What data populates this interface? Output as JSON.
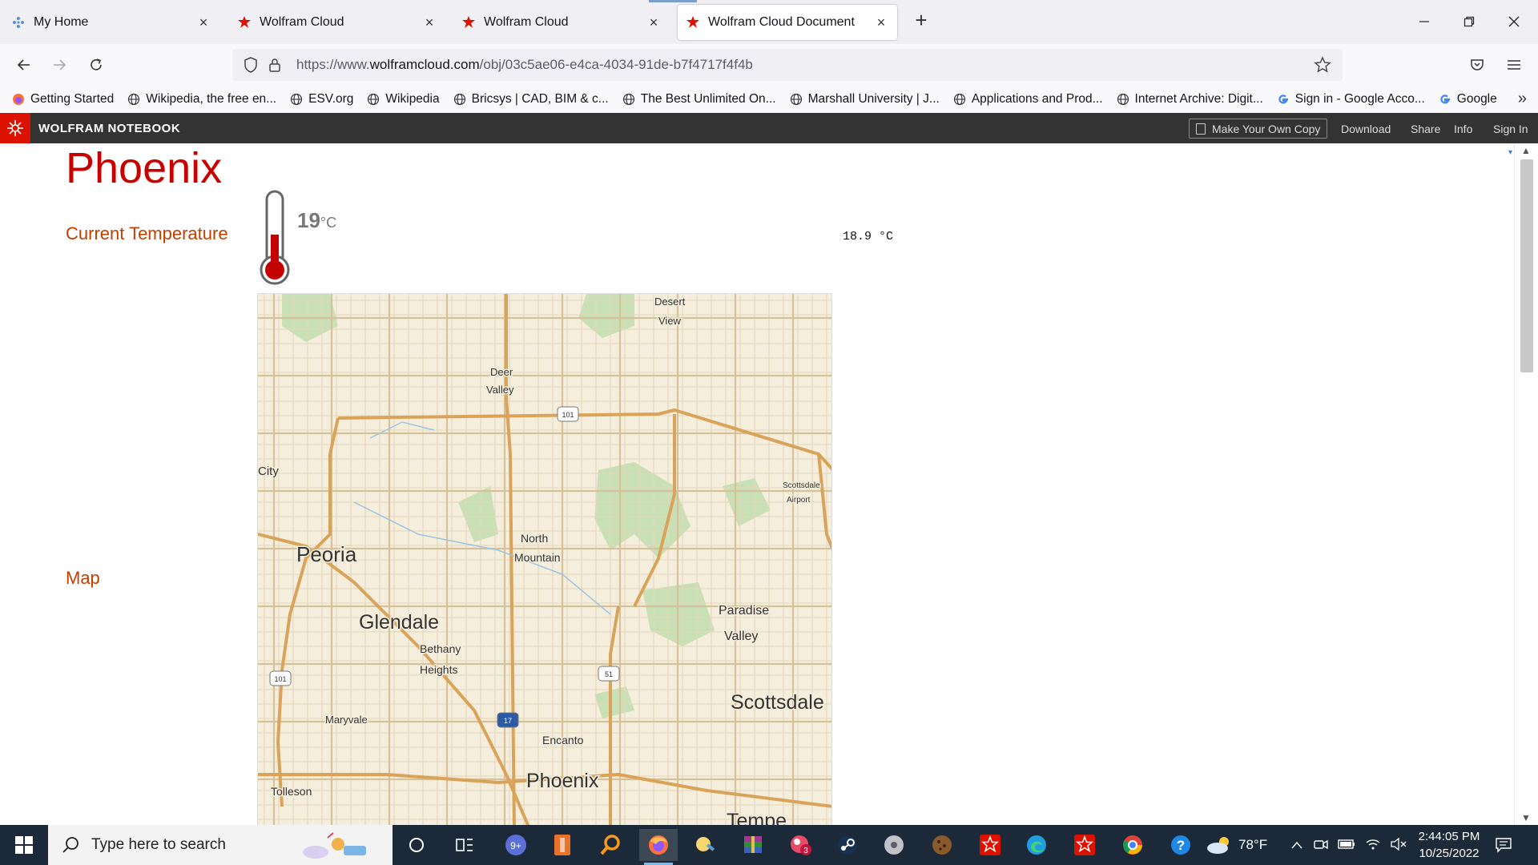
{
  "tabs": [
    {
      "label": "My Home",
      "icon": "wolfram-snowflake-icon"
    },
    {
      "label": "Wolfram Cloud",
      "icon": "wolfram-spikey-icon"
    },
    {
      "label": "Wolfram Cloud",
      "icon": "wolfram-spikey-icon"
    },
    {
      "label": "Wolfram Cloud Document",
      "icon": "wolfram-spikey-icon",
      "active": true
    }
  ],
  "address": {
    "prefix": "https://www.",
    "domain": "wolframcloud.com",
    "path": "/obj/03c5ae06-e4ca-4034-91de-b7f4717f4f4b"
  },
  "bookmarks": [
    {
      "label": "Getting Started",
      "icon": "firefox-icon"
    },
    {
      "label": "Wikipedia, the free en...",
      "icon": "globe-icon"
    },
    {
      "label": "ESV.org",
      "icon": "globe-icon"
    },
    {
      "label": "Wikipedia",
      "icon": "globe-icon"
    },
    {
      "label": "Bricsys | CAD, BIM & c...",
      "icon": "globe-icon"
    },
    {
      "label": "The Best Unlimited On...",
      "icon": "globe-icon"
    },
    {
      "label": "Marshall University | J...",
      "icon": "globe-icon"
    },
    {
      "label": "Applications and Prod...",
      "icon": "globe-icon"
    },
    {
      "label": "Internet Archive: Digit...",
      "icon": "globe-icon"
    },
    {
      "label": "Sign in - Google Acco...",
      "icon": "google-icon"
    },
    {
      "label": "Google",
      "icon": "google-icon"
    }
  ],
  "wolfram_bar": {
    "title": "WOLFRAM NOTEBOOK",
    "make_copy": "Make Your Own Copy",
    "download": "Download",
    "share": "Share",
    "info": "Info",
    "sign_in": "Sign In"
  },
  "notebook": {
    "heading": "Phoenix",
    "current_temperature_label": "Current Temperature",
    "thermometer_value": "19",
    "thermometer_unit": "°C",
    "thermometer_level": 0.48,
    "temperature_output": "18.9 °C",
    "map_label": "Map"
  },
  "map": {
    "places": [
      {
        "text": "Desert"
      },
      {
        "text": "View"
      },
      {
        "text": "Deer"
      },
      {
        "text": "Valley"
      },
      {
        "text": "Peoria"
      },
      {
        "text": "North"
      },
      {
        "text": "Mountain"
      },
      {
        "text": "Glendale"
      },
      {
        "text": "Bethany"
      },
      {
        "text": "Heights"
      },
      {
        "text": "Paradise"
      },
      {
        "text": "Valley"
      },
      {
        "text": "Scottsdale"
      },
      {
        "text": "Maryvale"
      },
      {
        "text": "Encanto"
      },
      {
        "text": "Phoenix"
      },
      {
        "text": "Tolleson"
      },
      {
        "text": "Tempe"
      },
      {
        "text": "City"
      },
      {
        "text": "Scottsdale"
      },
      {
        "text": "Airport"
      }
    ],
    "shields": [
      "101",
      "101",
      "51",
      "17"
    ]
  },
  "taskbar": {
    "search_placeholder": "Type here to search",
    "weather": "78°F",
    "time": "2:44:05 PM",
    "date": "10/25/2022"
  }
}
